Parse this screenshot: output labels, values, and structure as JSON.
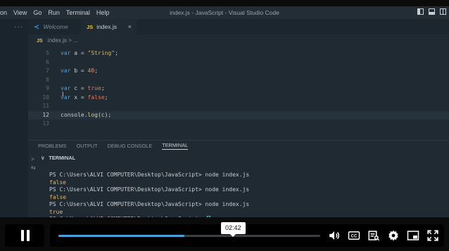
{
  "menu": [
    "on",
    "View",
    "Go",
    "Run",
    "Terminal",
    "Help"
  ],
  "window_title": "index.js - JavaScript - Visual Studio Code",
  "sidebar_dots": "···",
  "tabs": [
    {
      "label": "Welcome",
      "icon": "vscode-icon"
    },
    {
      "label": "index.js",
      "icon": "JS",
      "close": "×"
    }
  ],
  "breadcrumb": {
    "icon": "JS",
    "file": "index.js",
    "more": "> ..."
  },
  "editor_lines": [
    {
      "n": "5",
      "tokens": [
        [
          "kw",
          "var"
        ],
        [
          "p",
          " a = "
        ],
        [
          "str",
          "\"String\""
        ],
        [
          "p",
          ";"
        ]
      ]
    },
    {
      "n": "6",
      "tokens": []
    },
    {
      "n": "7",
      "tokens": [
        [
          "kw",
          "var"
        ],
        [
          "p",
          " b = "
        ],
        [
          "num",
          "40"
        ],
        [
          "p",
          ";"
        ]
      ]
    },
    {
      "n": "8",
      "tokens": []
    },
    {
      "n": "9",
      "tokens": [
        [
          "kw",
          "var"
        ],
        [
          "p",
          " c = "
        ],
        [
          "bool",
          "true"
        ],
        [
          "p",
          ";"
        ]
      ]
    },
    {
      "n": "10",
      "tokens": [
        [
          "kw",
          "var"
        ],
        [
          "p",
          " x = "
        ],
        [
          "bool",
          "false"
        ],
        [
          "p",
          ";"
        ]
      ]
    },
    {
      "n": "11",
      "tokens": []
    },
    {
      "n": "12",
      "tokens": [
        [
          "p",
          "console."
        ],
        [
          "fn",
          "log"
        ],
        [
          "p",
          "(c);"
        ]
      ]
    },
    {
      "n": "13",
      "tokens": []
    }
  ],
  "current_line": "12",
  "text_cursor": "I",
  "panel_tabs": [
    "PROBLEMS",
    "OUTPUT",
    "DEBUG CONSOLE",
    "TERMINAL"
  ],
  "active_panel_tab": "TERMINAL",
  "terminal_header": "TERMINAL",
  "terminal_chevron": "∨",
  "terminal_side_glyphs": [
    ">",
    "⇆"
  ],
  "terminal_lines": [
    {
      "type": "cmd",
      "text": "PS C:\\Users\\ALVI COMPUTER\\Desktop\\JavaScript> node index.js"
    },
    {
      "type": "out",
      "text": "false"
    },
    {
      "type": "cmd",
      "text": "PS C:\\Users\\ALVI COMPUTER\\Desktop\\JavaScript> node index.js"
    },
    {
      "type": "out",
      "text": "false"
    },
    {
      "type": "cmd",
      "text": "PS C:\\Users\\ALVI COMPUTER\\Desktop\\JavaScript> node index.js"
    },
    {
      "type": "out",
      "text": "true"
    },
    {
      "type": "prompt",
      "text": "PS C:\\Users\\ALVI COMPUTER\\Desktop\\JavaScript> "
    }
  ],
  "player": {
    "time": "02:42",
    "progress": 0.48,
    "accent": "#4aa3df",
    "icons": [
      "pause-icon",
      "volume-icon",
      "captions-icon",
      "transcript-icon",
      "settings-icon",
      "pip-icon",
      "fullscreen-icon"
    ]
  }
}
